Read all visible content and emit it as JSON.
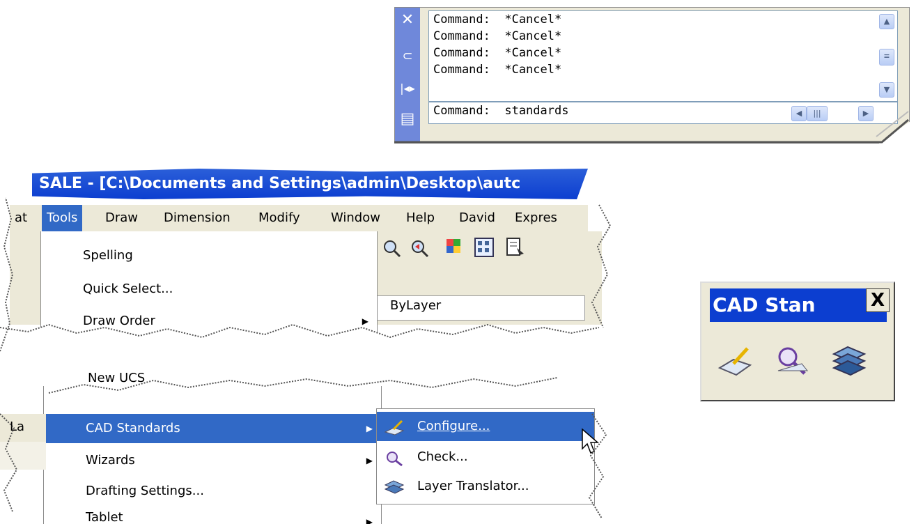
{
  "command_window": {
    "history": [
      "Command:  *Cancel*",
      "Command:  *Cancel*",
      "Command:  *Cancel*",
      "Command:  *Cancel*"
    ],
    "input": "Command:  standards",
    "side_icons": [
      "close-icon",
      "pin-icon",
      "autohide-icon",
      "properties-icon"
    ]
  },
  "tools_screenshot": {
    "title": "SALE - [C:\\Documents and Settings\\admin\\Desktop\\autc",
    "menubar": [
      "at",
      "Tools",
      "Draw",
      "Dimension",
      "Modify",
      "Window",
      "Help",
      "David",
      "Expres"
    ],
    "menu_top": [
      "Spelling",
      "Quick Select...",
      "Draw Order"
    ],
    "menu_partial": "New UCS",
    "menu_bottom": [
      "CAD Standards",
      "Wizards",
      "Drafting Settings...",
      "Tablet"
    ],
    "submenu": [
      "Configure...",
      "Check...",
      "Layer Translator..."
    ],
    "bylayer": "ByLayer",
    "left_fragment": "La"
  },
  "cad_toolbar": {
    "title": "CAD Stan",
    "close": "X",
    "buttons": [
      "configure-standards-icon",
      "check-standards-icon",
      "layer-translator-icon"
    ]
  },
  "colors": {
    "accent": "#3169c6",
    "titlebar": "#0c3ed0",
    "menu_bg": "#ece9d8",
    "sidebar": "#6f88da"
  }
}
